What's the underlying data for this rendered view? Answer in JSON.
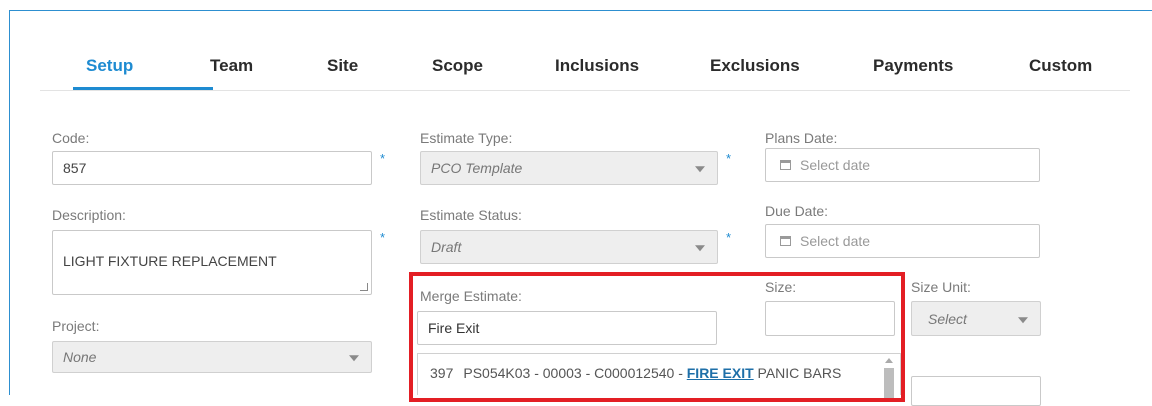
{
  "tabs": [
    {
      "label": "Setup",
      "active": true
    },
    {
      "label": "Team"
    },
    {
      "label": "Site"
    },
    {
      "label": "Scope"
    },
    {
      "label": "Inclusions"
    },
    {
      "label": "Exclusions"
    },
    {
      "label": "Payments"
    },
    {
      "label": "Custom"
    }
  ],
  "form": {
    "code": {
      "label": "Code:",
      "value": "857",
      "required": "*"
    },
    "description": {
      "label": "Description:",
      "value": "LIGHT FIXTURE REPLACEMENT",
      "required": "*"
    },
    "project": {
      "label": "Project:",
      "value": "None"
    },
    "estimate_type": {
      "label": "Estimate Type:",
      "value": "PCO Template",
      "required": "*"
    },
    "estimate_status": {
      "label": "Estimate Status:",
      "value": "Draft",
      "required": "*"
    },
    "merge_estimate": {
      "label": "Merge Estimate:",
      "value": "Fire Exit"
    },
    "plans_date": {
      "label": "Plans Date:",
      "placeholder": "Select date"
    },
    "due_date": {
      "label": "Due Date:",
      "placeholder": "Select date"
    },
    "size": {
      "label": "Size:",
      "value": ""
    },
    "size_unit": {
      "label": "Size Unit:",
      "value": "Select"
    }
  },
  "autocomplete": {
    "item": {
      "number": "397",
      "prefix": "PS054K03 - 00003 - C000012540 - ",
      "match": "FIRE EXIT",
      "suffix": " PANIC BARS"
    }
  },
  "colors": {
    "accent": "#1e8bd1",
    "highlight_border": "#e31e24",
    "frame_border": "#2d8fd0"
  }
}
